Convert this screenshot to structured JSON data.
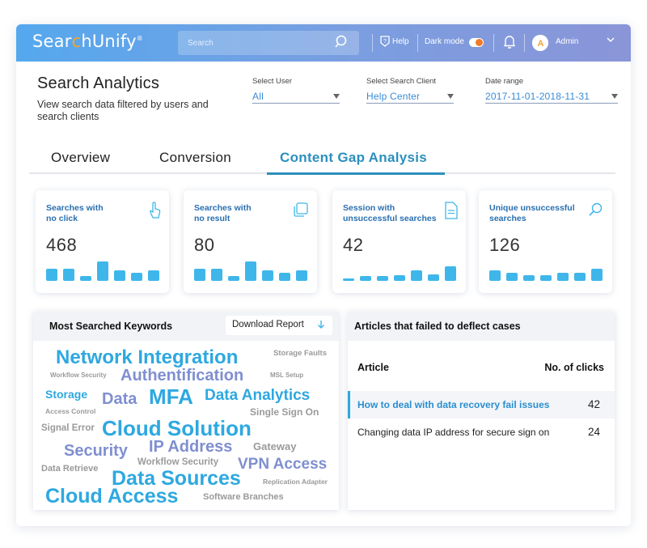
{
  "topbar": {
    "logo": {
      "pre": "Sear",
      "accent": "c",
      "post": "hUnify",
      "reg": "®"
    },
    "search_placeholder": "Search",
    "help_label": "Help",
    "dark_mode_label": "Dark mode",
    "user_name": "Admin",
    "avatar_letter": "A"
  },
  "header": {
    "title": "Search Analytics",
    "subtitle": "View search data filtered by users and search clients",
    "filters": {
      "user": {
        "label": "Select User",
        "value": "All"
      },
      "client": {
        "label": "Select Search Client",
        "value": "Help Center"
      },
      "date": {
        "label": "Date range",
        "value": "2017-11-01-2018-11-31"
      }
    }
  },
  "tabs": [
    "Overview",
    "Conversion",
    "Content Gap Analysis"
  ],
  "active_tab": 2,
  "cards": [
    {
      "title_1": "Searches with",
      "title_2": "no click",
      "value": "468",
      "icon": "pointer-icon",
      "bars": [
        0.55,
        0.55,
        0.2,
        0.85,
        0.45,
        0.35,
        0.45
      ]
    },
    {
      "title_1": "Searches with",
      "title_2": "no result",
      "value": "80",
      "icon": "copy-icon",
      "bars": [
        0.55,
        0.55,
        0.2,
        0.85,
        0.45,
        0.35,
        0.45
      ]
    },
    {
      "title_1": "Session with",
      "title_2": "unsuccessful searches",
      "value": "42",
      "icon": "document-icon",
      "bars": [
        0.1,
        0.2,
        0.2,
        0.25,
        0.45,
        0.3,
        0.65
      ]
    },
    {
      "title_1": "Unique unsuccessful",
      "title_2": "searches",
      "value": "126",
      "icon": "search-icon",
      "bars": [
        0.45,
        0.35,
        0.25,
        0.25,
        0.35,
        0.35,
        0.55
      ]
    }
  ],
  "keywords_panel": {
    "title": "Most Searched Keywords",
    "download_label": "Download Report",
    "words": {
      "w1": "Network Integration",
      "w2": "Storage Faults",
      "w3": "Workflow Security",
      "w4": "Authentification",
      "w5": "MSL Setup",
      "w6": "Storage",
      "w7": "Data",
      "w8": "MFA",
      "w9": "Data Analytics",
      "w10": "Access Control",
      "w11": "Single Sign On",
      "w12": "Signal Error",
      "w13": "Cloud Solution",
      "w14": "Security",
      "w15": "IP Address",
      "w16": "Gateway",
      "w17": "Workflow Security",
      "w18": "VPN Access",
      "w19": "Data Retrieve",
      "w20": "Data Sources",
      "w21": "Replication Adapter",
      "w22": "Cloud Access",
      "w23": "Software Branches"
    }
  },
  "articles_panel": {
    "title": "Articles that failed to deflect cases",
    "col_article": "Article",
    "col_clicks": "No. of clicks",
    "rows": [
      {
        "article": "How to deal with data recovery fail issues",
        "clicks": "42"
      },
      {
        "article": "Changing data IP address for secure sign on",
        "clicks": "24"
      }
    ]
  },
  "colors": {
    "accent": "#2ea8e0",
    "bar": "#3fb6ea",
    "secondary_word": "#7f8fd0"
  }
}
